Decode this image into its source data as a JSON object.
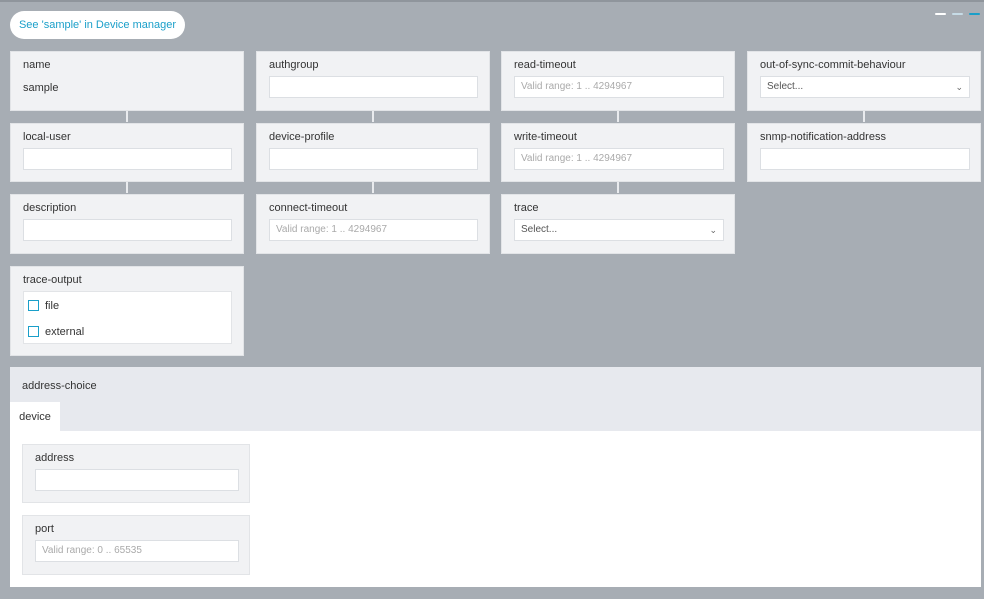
{
  "device_manager_link": "See 'sample' in Device manager",
  "fields": {
    "name": {
      "label": "name",
      "value": "sample"
    },
    "authgroup": {
      "label": "authgroup",
      "value": ""
    },
    "read_timeout": {
      "label": "read-timeout",
      "placeholder": "Valid range: 1 .. 4294967"
    },
    "out_of_sync": {
      "label": "out-of-sync-commit-behaviour",
      "selected": "Select..."
    },
    "local_user": {
      "label": "local-user",
      "value": ""
    },
    "device_profile": {
      "label": "device-profile",
      "value": ""
    },
    "write_timeout": {
      "label": "write-timeout",
      "placeholder": "Valid range: 1 .. 4294967"
    },
    "snmp_notification_address": {
      "label": "snmp-notification-address",
      "value": ""
    },
    "description": {
      "label": "description",
      "value": ""
    },
    "connect_timeout": {
      "label": "connect-timeout",
      "placeholder": "Valid range: 1 .. 4294967"
    },
    "trace": {
      "label": "trace",
      "selected": "Select..."
    },
    "trace_output": {
      "label": "trace-output",
      "options": [
        "file",
        "external"
      ]
    }
  },
  "address_choice": {
    "label": "address-choice",
    "tabs": [
      "device"
    ],
    "address": {
      "label": "address",
      "value": ""
    },
    "port": {
      "label": "port",
      "placeholder": "Valid range: 0 .. 65535"
    }
  },
  "colors": {
    "accent": "#1a9fc9",
    "background": "#a7adb4",
    "card": "#f1f2f4"
  }
}
